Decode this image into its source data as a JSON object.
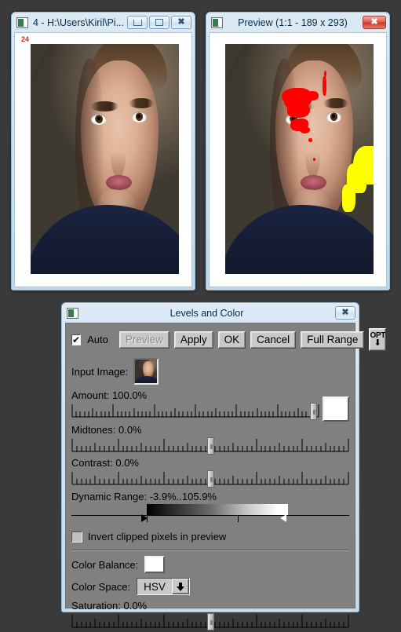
{
  "desktop": {
    "background": "#3a3a3a"
  },
  "image_window": {
    "title": "4 - H:\\Users\\Kiril\\Pi...",
    "icon": "image-window-icon",
    "overlay_number": "24",
    "buttons": {
      "minimize": "minimize-button",
      "maximize": "maximize-button",
      "close": "close-button"
    }
  },
  "preview_window": {
    "title": "Preview (1:1 - 189 x 293)",
    "icon": "preview-window-icon",
    "close": "close-button",
    "clipping": {
      "highlight_color": "#fe0000",
      "shadow_color": "#ffff00"
    }
  },
  "dialog": {
    "title": "Levels and Color",
    "icon": "dialog-icon",
    "close": "close-button",
    "toolbar": {
      "auto_label": "Auto",
      "auto_checked": "✔",
      "preview_label": "Preview",
      "apply_label": "Apply",
      "ok_label": "OK",
      "cancel_label": "Cancel",
      "full_range_label": "Full Range",
      "opt_label": "OPT",
      "opt_arrow": "⬇"
    },
    "input_image": {
      "label": "Input Image:"
    },
    "amount": {
      "label": "Amount: 100.0%",
      "value": 100.0,
      "handle_pct": 99
    },
    "midtones": {
      "label": "Midtones: 0.0%",
      "value": 0.0,
      "handle_pct": 50
    },
    "contrast": {
      "label": "Contrast: 0.0%",
      "value": 0.0,
      "handle_pct": 50
    },
    "dynamic_range": {
      "label": "Dynamic Range: -3.9%..105.9%",
      "low": -3.9,
      "high": 105.9,
      "grad_start_pct": 27,
      "grad_end_pct": 78,
      "black_marker_pct": 25,
      "white_marker_pct": 75,
      "mid_tick_pct": 60
    },
    "invert_clipped": {
      "label": "Invert clipped pixels in preview",
      "checked": false
    },
    "color_balance": {
      "label": "Color Balance:",
      "swatch": "#ffffff"
    },
    "color_space": {
      "label": "Color Space:",
      "value": "HSV"
    },
    "saturation": {
      "label": "Saturation: 0.0%",
      "value": 0.0,
      "handle_pct": 50
    }
  }
}
